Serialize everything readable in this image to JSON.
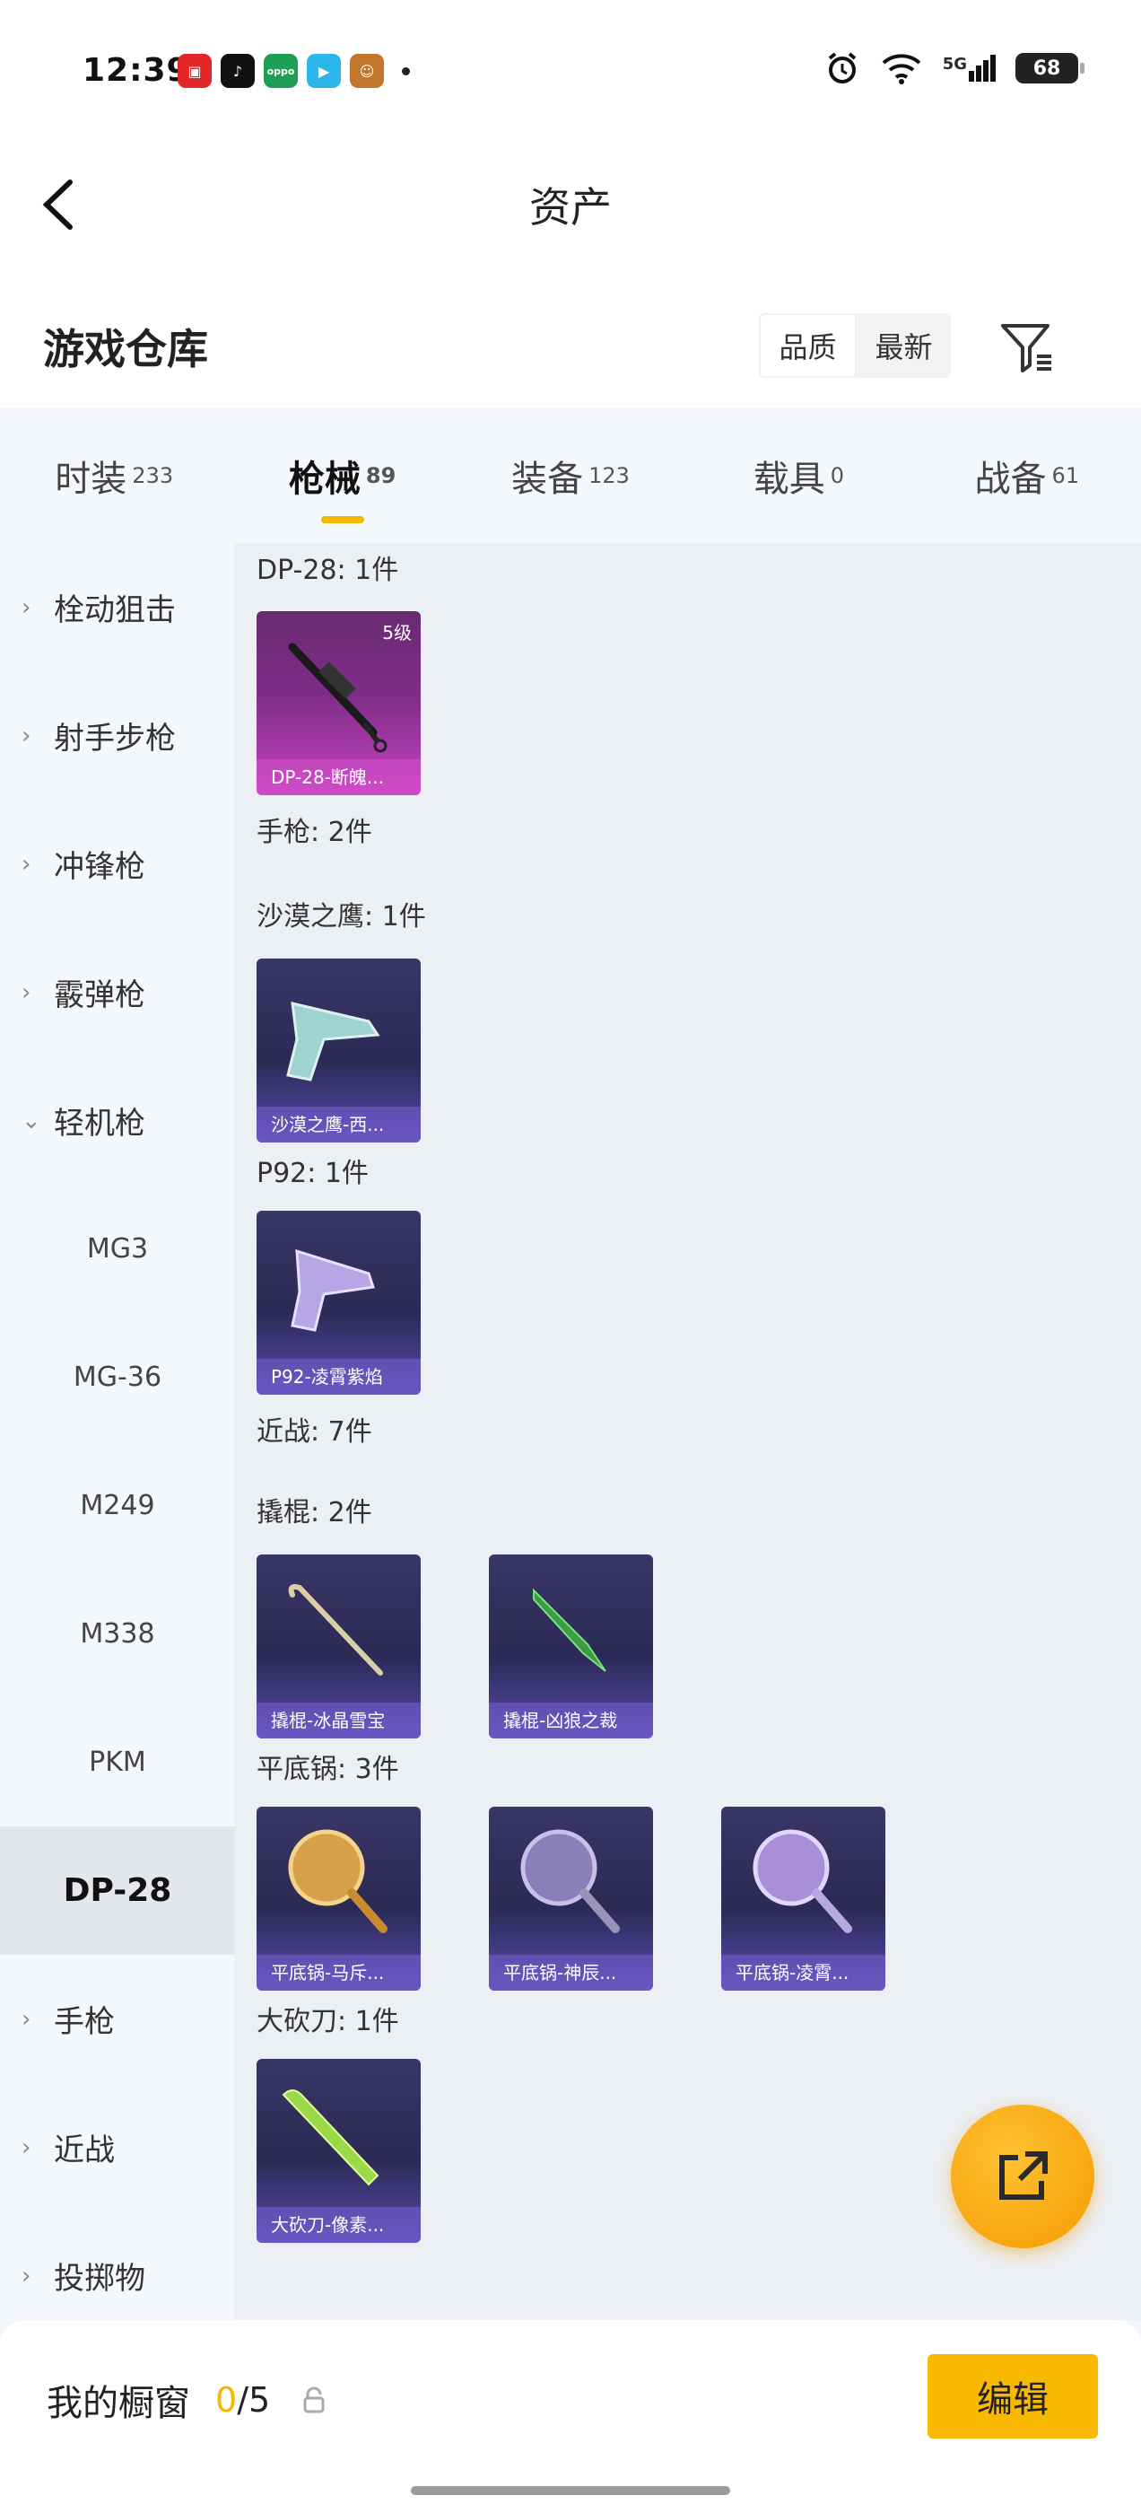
{
  "status": {
    "time": "12:39",
    "network": "5G",
    "battery": "68",
    "notif_apps": [
      "app-icon-red",
      "tiktok-icon",
      "oppo-icon",
      "video-app-icon",
      "game-avatar-icon"
    ]
  },
  "nav": {
    "title": "资产"
  },
  "warehouse": {
    "title": "游戏仓库",
    "sort_quality": "品质",
    "sort_latest": "最新"
  },
  "tabs": [
    {
      "label": "时装",
      "count": "233"
    },
    {
      "label": "枪械",
      "count": "89"
    },
    {
      "label": "装备",
      "count": "123"
    },
    {
      "label": "载具",
      "count": "0"
    },
    {
      "label": "战备",
      "count": "61"
    }
  ],
  "sidebar": {
    "items": [
      {
        "label": "栓动狙击"
      },
      {
        "label": "射手步枪"
      },
      {
        "label": "冲锋枪"
      },
      {
        "label": "霰弹枪"
      },
      {
        "label": "轻机枪"
      },
      {
        "label": "MG3"
      },
      {
        "label": "MG-36"
      },
      {
        "label": "M249"
      },
      {
        "label": "M338"
      },
      {
        "label": "PKM"
      },
      {
        "label": "DP-28"
      },
      {
        "label": "手枪"
      },
      {
        "label": "近战"
      },
      {
        "label": "投掷物"
      }
    ]
  },
  "content": {
    "dp28_label": "DP-28: 1件",
    "dp28_card": {
      "level": "5级",
      "caption": "DP-28-断魄..."
    },
    "pistol_label": "手枪: 2件",
    "deagle_label": "沙漠之鹰: 1件",
    "deagle_card": {
      "caption": "沙漠之鹰-西..."
    },
    "p92_label": "P92: 1件",
    "p92_card": {
      "caption": "P92-凌霄紫焰"
    },
    "melee_label": "近战: 7件",
    "crowbar_label": "撬棍: 2件",
    "crowbar_cards": [
      {
        "caption": "撬棍-冰晶雪宝"
      },
      {
        "caption": "撬棍-凶狼之裁"
      }
    ],
    "pan_label": "平底锅: 3件",
    "pan_cards": [
      {
        "caption": "平底锅-马斥..."
      },
      {
        "caption": "平底锅-神辰..."
      },
      {
        "caption": "平底锅-凌霄..."
      }
    ],
    "machete_label": "大砍刀: 1件",
    "machete_card": {
      "caption": "大砍刀-像素..."
    }
  },
  "bottom": {
    "shelf_label": "我的橱窗",
    "shelf_used": "0",
    "shelf_total": "/5",
    "edit_label": "编辑"
  },
  "colors": {
    "accent": "#f5b700",
    "fab": "#f8a000"
  }
}
